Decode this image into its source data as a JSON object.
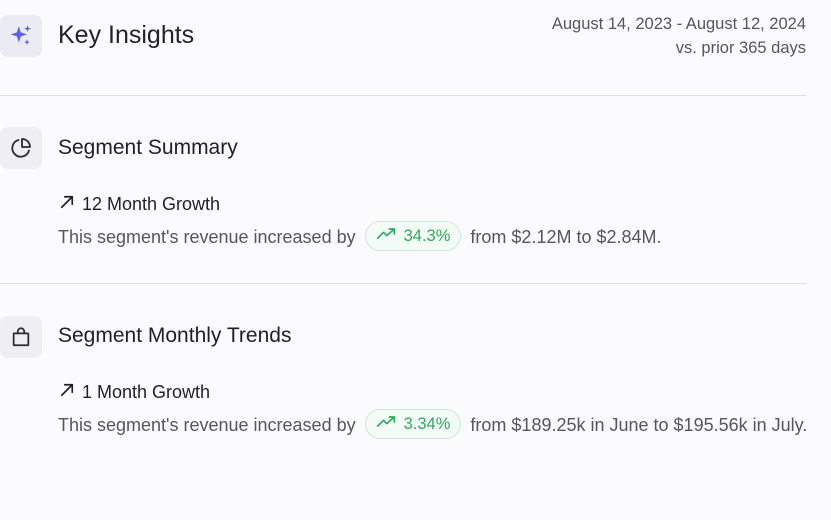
{
  "header": {
    "title": "Key Insights",
    "date_range": "August 14, 2023 - August 12, 2024",
    "comparison": "vs. prior 365 days"
  },
  "segment_summary": {
    "title": "Segment Summary",
    "insight_title": "12 Month Growth",
    "text_before": "This segment's revenue increased by",
    "change": "34.3%",
    "text_after": "from $2.12M to $2.84M."
  },
  "segment_monthly": {
    "title": "Segment Monthly Trends",
    "insight_title": "1 Month Growth",
    "text_before": "This segment's revenue increased by",
    "change": "3.34%",
    "text_after": "from $189.25k in June to $195.56k in July."
  },
  "colors": {
    "accent": "#5b5ff0",
    "positive": "#2eaa5c"
  },
  "icons": {
    "header": "sparkles-icon",
    "summary": "pie-chart-icon",
    "monthly": "shopping-bag-icon",
    "growth": "arrow-up-right-icon",
    "trend": "trending-up-icon"
  }
}
